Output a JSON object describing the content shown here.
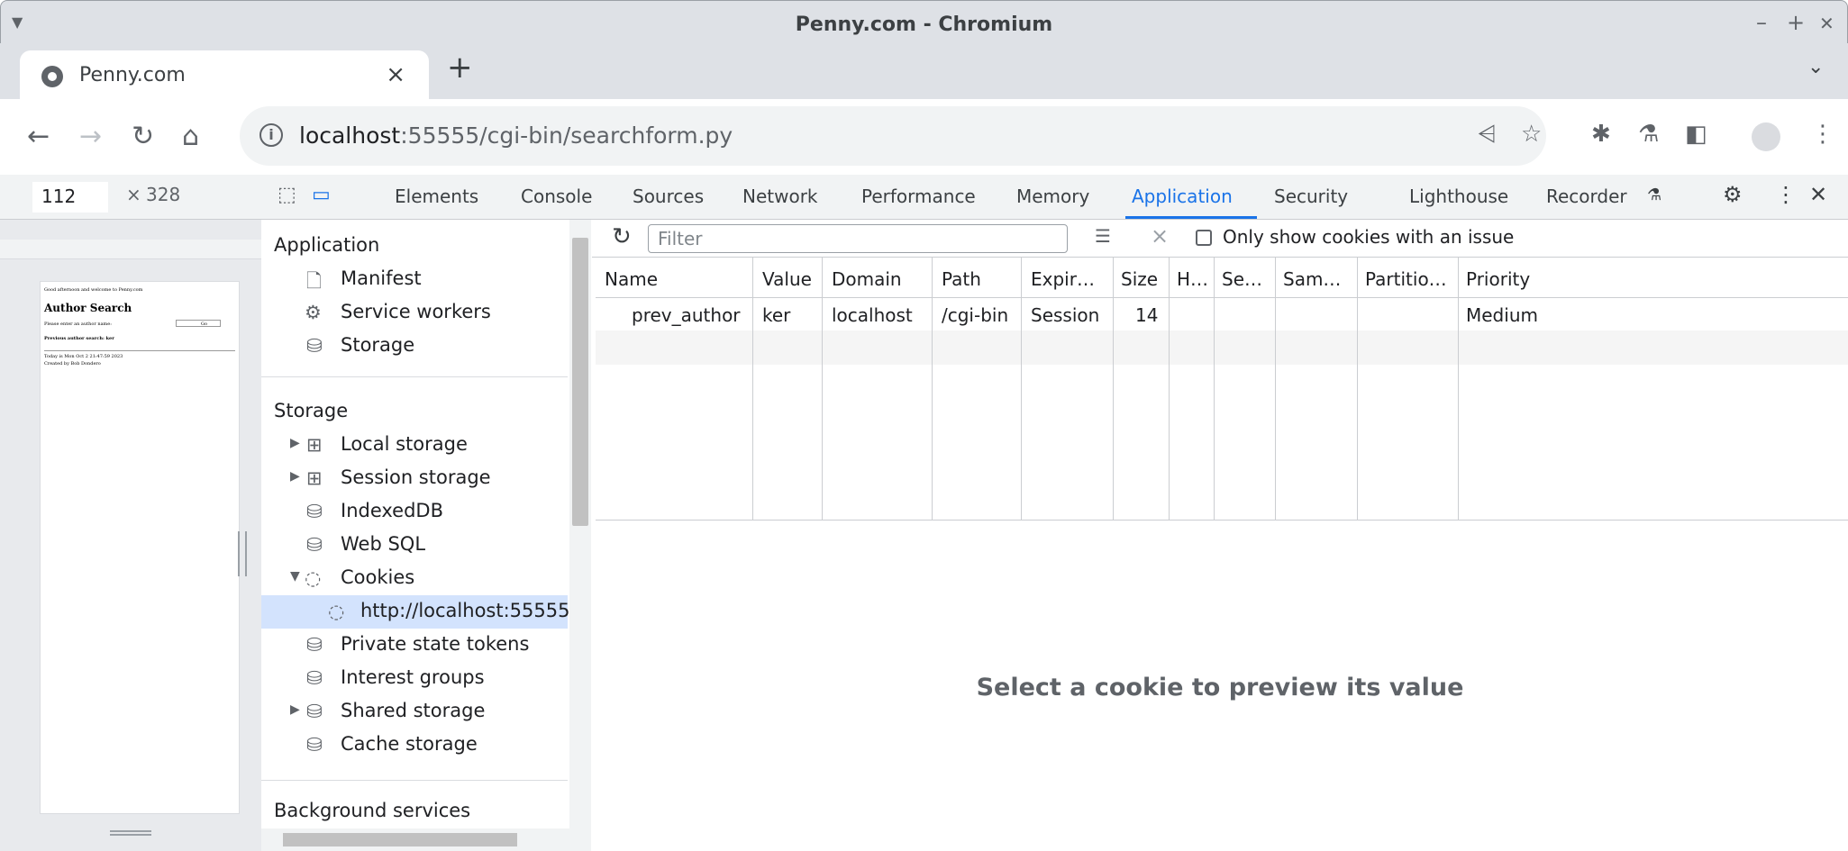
{
  "window": {
    "title": "Penny.com - Chromium",
    "controls": [
      "–",
      "+",
      "✕"
    ]
  },
  "tab": {
    "title": "Penny.com"
  },
  "toolbar": {
    "url_host": "localhost",
    "url_rest": ":55555/cgi-bin/searchform.py"
  },
  "device": {
    "width": "112",
    "times": "×",
    "height": "328"
  },
  "preview": {
    "greeting": "Good afternoon and welcome to Penny.com",
    "heading": "Author Search",
    "prompt": "Please enter an author name:",
    "go": "Go",
    "previous": "Previous author search: ker",
    "date": "Today is Mon Oct 2 21:47:59 2023",
    "credit": "Created by Bob Dondero"
  },
  "devtools": {
    "tabs": [
      "Elements",
      "Console",
      "Sources",
      "Network",
      "Performance",
      "Memory",
      "Application",
      "Security",
      "Lighthouse",
      "Recorder"
    ],
    "active_tab": "Application"
  },
  "sidebar": {
    "section_application": "Application",
    "application_items": [
      "Manifest",
      "Service workers",
      "Storage"
    ],
    "section_storage": "Storage",
    "storage_items": [
      "Local storage",
      "Session storage",
      "IndexedDB",
      "Web SQL",
      "Cookies",
      "http://localhost:55555",
      "Private state tokens",
      "Interest groups",
      "Shared storage",
      "Cache storage"
    ],
    "section_background": "Background services"
  },
  "filter": {
    "placeholder": "Filter",
    "only_issues": "Only show cookies with an issue"
  },
  "table": {
    "headers": [
      "Name",
      "Value",
      "Domain",
      "Path",
      "Expir…",
      "Size",
      "H…",
      "Se…",
      "Sam…",
      "Partitio…",
      "Priority"
    ],
    "rows": [
      [
        "prev_author",
        "ker",
        "localhost",
        "/cgi-bin",
        "Session",
        "14",
        "",
        "",
        "",
        "",
        "Medium"
      ]
    ]
  },
  "preview_message": "Select a cookie to preview its value"
}
